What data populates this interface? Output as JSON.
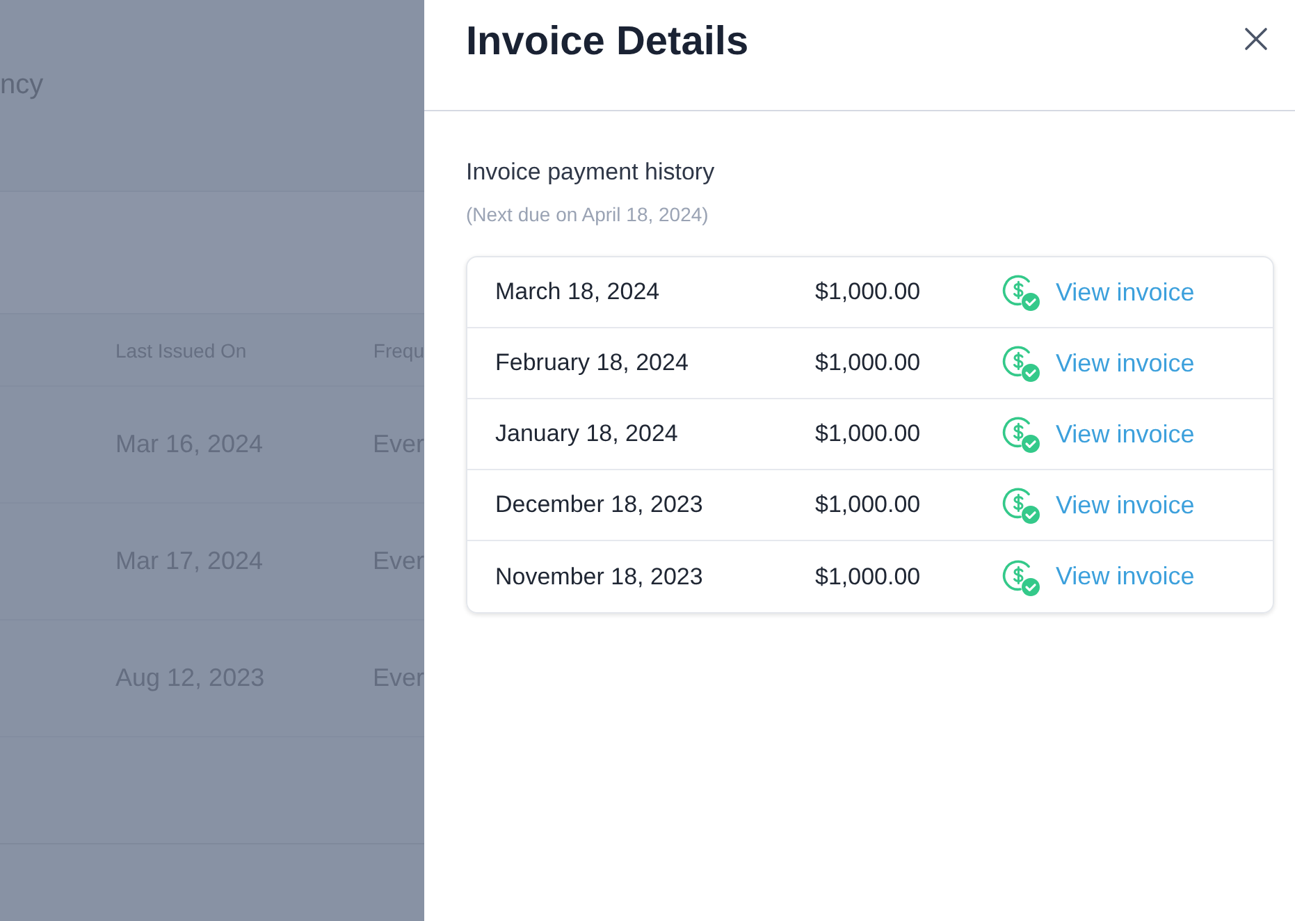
{
  "background": {
    "heading": "ncy",
    "table": {
      "columns": [
        "Last Issued On",
        "Frequ"
      ],
      "rows": [
        [
          "Mar 16, 2024",
          "Ever"
        ],
        [
          "Mar 17, 2024",
          "Ever"
        ],
        [
          "Aug 12, 2023",
          "Ever"
        ]
      ]
    }
  },
  "panel": {
    "title": "Invoice Details",
    "section_title": "Invoice payment history",
    "next_due": "(Next due on April 18, 2024)",
    "payments": [
      {
        "date": "March 18, 2024",
        "amount": "$1,000.00",
        "link": "View invoice"
      },
      {
        "date": "February 18, 2024",
        "amount": "$1,000.00",
        "link": "View invoice"
      },
      {
        "date": "January 18, 2024",
        "amount": "$1,000.00",
        "link": "View invoice"
      },
      {
        "date": "December 18, 2023",
        "amount": "$1,000.00",
        "link": "View invoice"
      },
      {
        "date": "November 18, 2023",
        "amount": "$1,000.00",
        "link": "View invoice"
      }
    ]
  }
}
